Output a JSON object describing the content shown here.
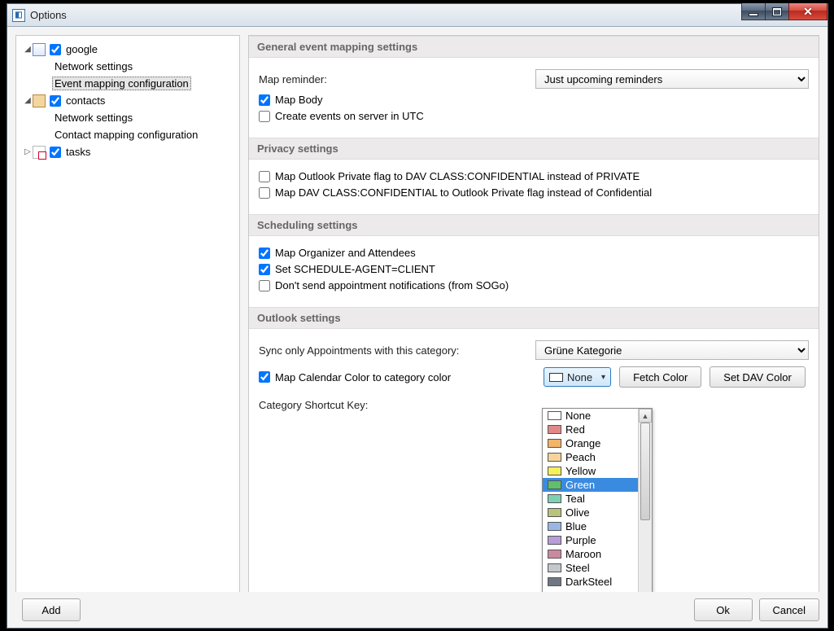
{
  "window": {
    "title": "Options"
  },
  "tree": {
    "google": {
      "label": "google",
      "checked": true,
      "children": {
        "network": "Network settings",
        "eventmap": "Event mapping configuration"
      }
    },
    "contacts": {
      "label": "contacts",
      "checked": true,
      "children": {
        "network": "Network settings",
        "contactmap": "Contact mapping configuration"
      }
    },
    "tasks": {
      "label": "tasks",
      "checked": true
    }
  },
  "general": {
    "header": "General event mapping settings",
    "map_reminder_label": "Map reminder:",
    "map_reminder_value": "Just upcoming reminders",
    "map_body": {
      "label": "Map Body",
      "checked": true
    },
    "utc": {
      "label": "Create events on server in UTC",
      "checked": false
    }
  },
  "privacy": {
    "header": "Privacy settings",
    "p1": {
      "label": "Map Outlook Private flag to DAV CLASS:CONFIDENTIAL instead of PRIVATE",
      "checked": false
    },
    "p2": {
      "label": "Map DAV CLASS:CONFIDENTIAL to Outlook Private flag instead of Confidential",
      "checked": false
    }
  },
  "scheduling": {
    "header": "Scheduling settings",
    "s1": {
      "label": "Map Organizer and Attendees",
      "checked": true
    },
    "s2": {
      "label": "Set SCHEDULE-AGENT=CLIENT",
      "checked": true
    },
    "s3": {
      "label": "Don't send appointment notifications (from SOGo)",
      "checked": false
    }
  },
  "outlook": {
    "header": "Outlook settings",
    "sync_cat_label": "Sync only Appointments with this category:",
    "sync_cat_value": "Grüne Kategorie",
    "map_color": {
      "label": "Map Calendar Color to category color",
      "checked": true
    },
    "color_dd_value": "None",
    "fetch_color": "Fetch Color",
    "set_dav_color": "Set DAV Color",
    "shortcut_label": "Category Shortcut Key:"
  },
  "color_list": [
    {
      "name": "None",
      "hex": "#ffffff"
    },
    {
      "name": "Red",
      "hex": "#e08a88"
    },
    {
      "name": "Orange",
      "hex": "#f2b36a"
    },
    {
      "name": "Peach",
      "hex": "#f4d49a"
    },
    {
      "name": "Yellow",
      "hex": "#f6f05a"
    },
    {
      "name": "Green",
      "hex": "#5fbf6a"
    },
    {
      "name": "Teal",
      "hex": "#7fd0b3"
    },
    {
      "name": "Olive",
      "hex": "#b8c47a"
    },
    {
      "name": "Blue",
      "hex": "#9ab6e6"
    },
    {
      "name": "Purple",
      "hex": "#b89ed6"
    },
    {
      "name": "Maroon",
      "hex": "#c98aa0"
    },
    {
      "name": "Steel",
      "hex": "#c4c8cc"
    },
    {
      "name": "DarkSteel",
      "hex": "#6f7782"
    }
  ],
  "color_selected": "Green",
  "footer": {
    "add": "Add",
    "ok": "Ok",
    "cancel": "Cancel"
  }
}
